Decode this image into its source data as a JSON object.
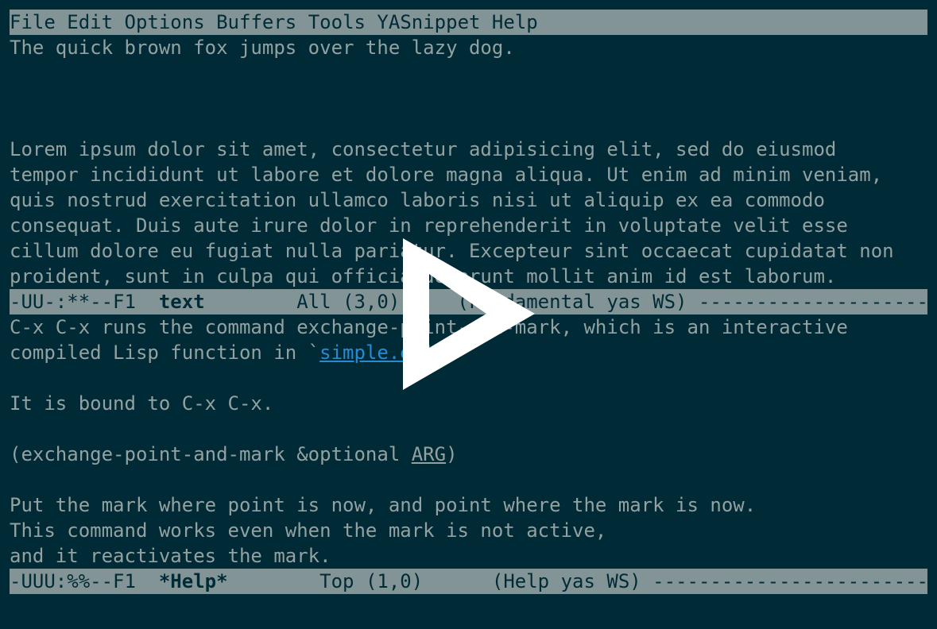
{
  "menu_bar": {
    "items": [
      "File",
      "Edit",
      "Options",
      "Buffers",
      "Tools",
      "YASnippet",
      "Help"
    ]
  },
  "text_buffer": {
    "lines": [
      "The quick brown fox jumps over the lazy dog.",
      "",
      "",
      "",
      "Lorem ipsum dolor sit amet, consectetur adipisicing elit, sed do eiusmod",
      "tempor incididunt ut labore et dolore magna aliqua. Ut enim ad minim veniam,",
      "quis nostrud exercitation ullamco laboris nisi ut aliquip ex ea commodo",
      "consequat. Duis aute irure dolor in reprehenderit in voluptate velit esse",
      "cillum dolore eu fugiat nulla pariatur. Excepteur sint occaecat cupidatat non",
      "proident, sunt in culpa qui officia deserunt mollit anim id est laborum."
    ]
  },
  "mode_line_text": {
    "prefix": "-UU-:**--F1  ",
    "buffer_name": "text",
    "suffix": "        All (3,0)     (Fundamental yas WS) ------------------------------"
  },
  "help_buffer": {
    "line1": "C-x C-x runs the command exchange-point-and-mark, which is an interactive",
    "line2_prefix": "compiled Lisp function in `",
    "line2_link": "simple.el",
    "line2_suffix": "'.",
    "line3": "",
    "line4": "It is bound to C-x C-x.",
    "line5": "",
    "line6_prefix": "(exchange-point-and-mark &optional ",
    "line6_arg": "ARG",
    "line6_suffix": ")",
    "line7": "",
    "line8": "Put the mark where point is now, and point where the mark is now.",
    "line9": "This command works even when the mark is not active,",
    "line10": "and it reactivates the mark."
  },
  "mode_line_help": {
    "prefix": "-UUU:%%--F1  ",
    "buffer_name": "*Help*",
    "suffix": "        Top (1,0)      (Help yas WS) ------------------------------------"
  },
  "colors": {
    "background": "#002b36",
    "foreground": "#93a1a1",
    "bar": "#839496",
    "link": "#268bd2"
  },
  "overlay_icon": "play-icon"
}
